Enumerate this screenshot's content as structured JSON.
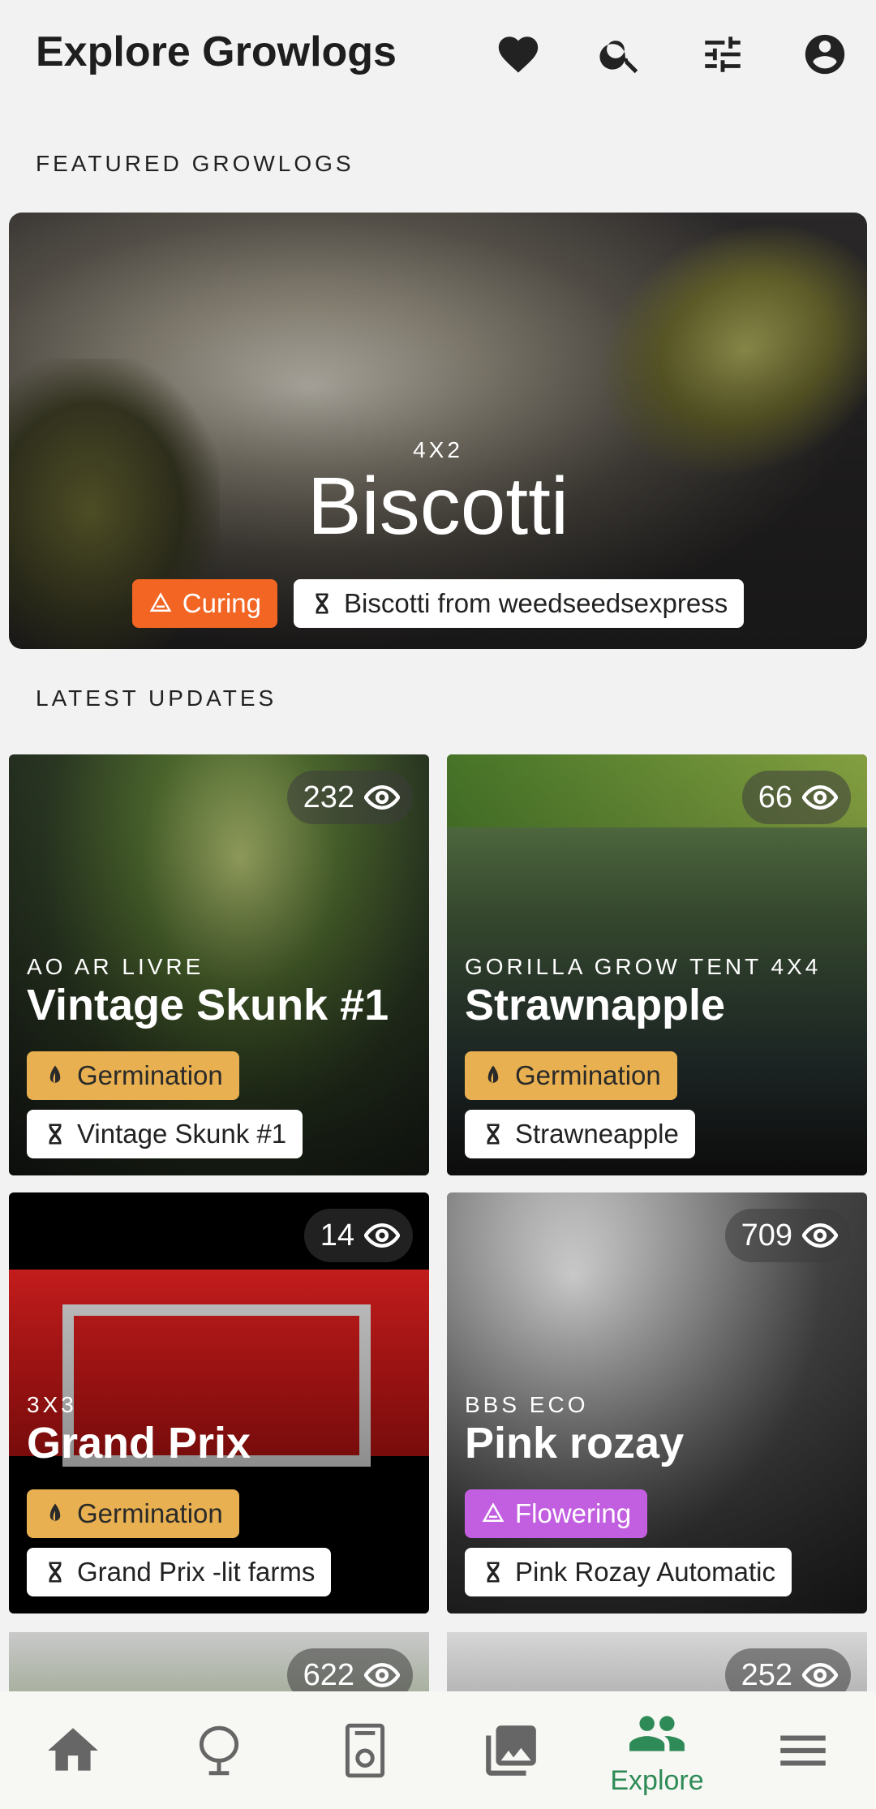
{
  "header": {
    "title": "Explore Growlogs",
    "icons": [
      "heart-icon",
      "search-icon",
      "filter-sliders-icon",
      "account-icon"
    ]
  },
  "sections": {
    "featured": "FEATURED GROWLOGS",
    "latest": "LATEST UPDATES"
  },
  "featured": {
    "subtitle": "4X2",
    "title": "Biscotti",
    "stage": "Curing",
    "strain": "Biscotti from weedseedsexpress"
  },
  "cards": [
    {
      "views": "232",
      "subtitle": "AO AR LIVRE",
      "title": "Vintage Skunk #1",
      "stage": "Germination",
      "strain": "Vintage Skunk #1"
    },
    {
      "views": "66",
      "subtitle": "GORILLA GROW TENT 4X4",
      "title": "Strawnapple",
      "stage": "Germination",
      "strain": "Strawneapple"
    },
    {
      "views": "14",
      "subtitle": "3X3",
      "title": "Grand Prix",
      "stage": "Germination",
      "strain": "Grand Prix -lit farms"
    },
    {
      "views": "709",
      "subtitle": "BBS ECO",
      "title": "Pink rozay",
      "stage": "Flowering",
      "strain": "Pink Rozay Automatic"
    },
    {
      "views": "622"
    },
    {
      "views": "252"
    }
  ],
  "nav": {
    "items": [
      "home-icon",
      "plant-tree-icon",
      "seed-packet-icon",
      "gallery-icon",
      "explore-people-icon",
      "menu-icon"
    ],
    "active_label": "Explore"
  },
  "colors": {
    "curing": "#f26522",
    "germination": "#e8b050",
    "flowering": "#c25fe0",
    "accent": "#2e8b57"
  }
}
